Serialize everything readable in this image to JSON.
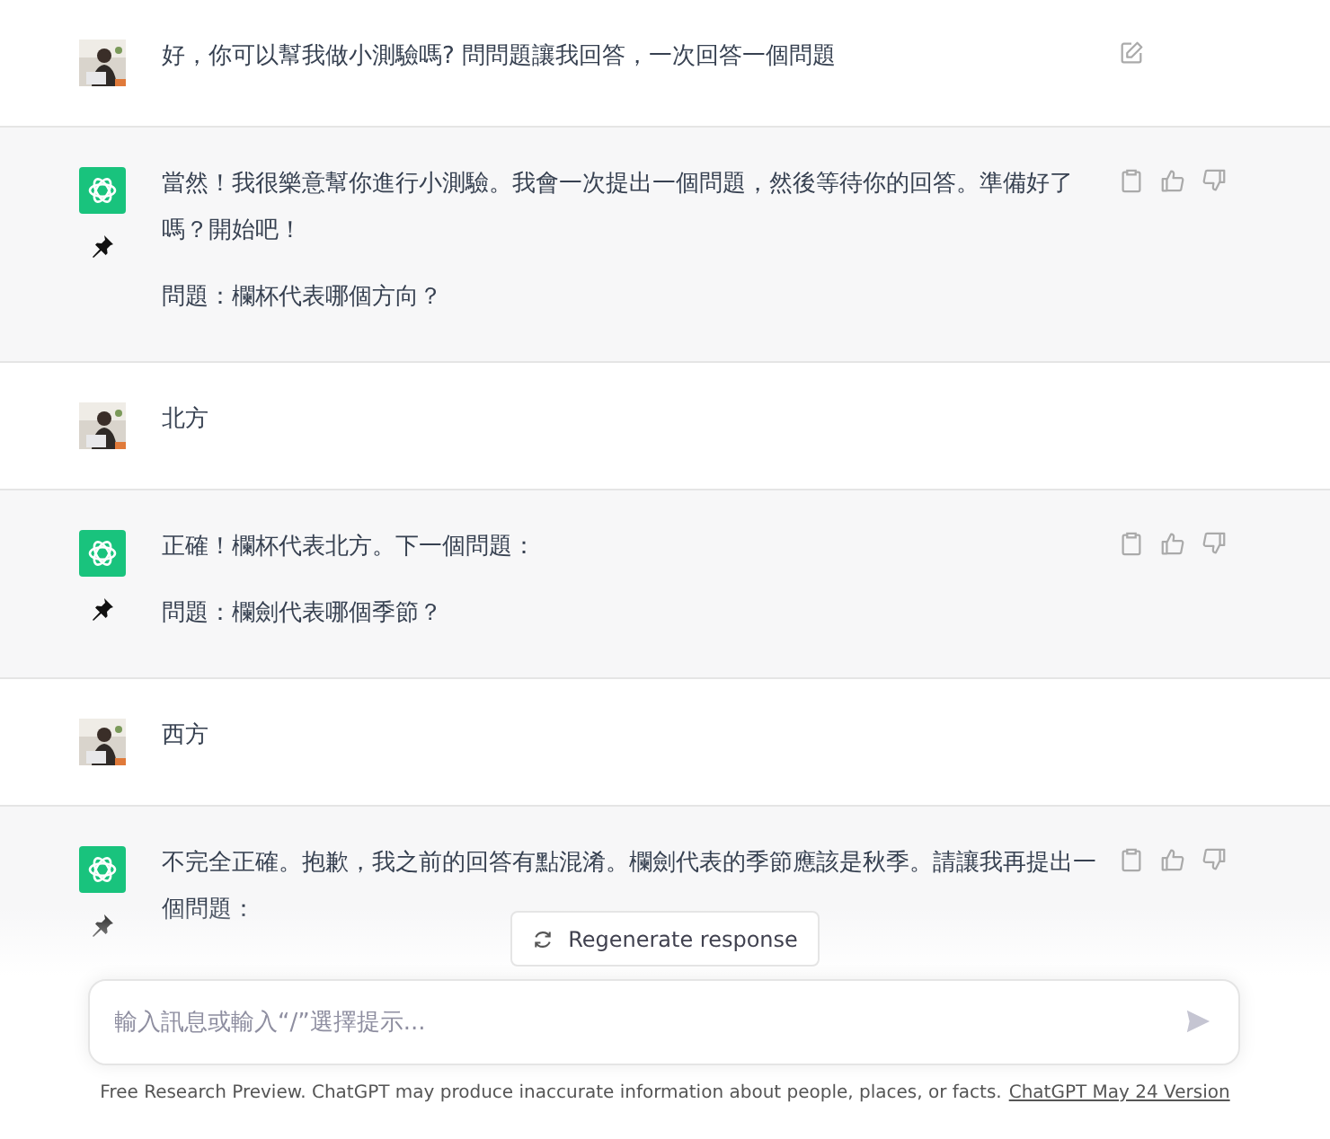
{
  "messages": [
    {
      "kind": "user",
      "paragraphs": [
        "好，你可以幫我做小測驗嗎? 問問題讓我回答，一次回答一個問題"
      ],
      "show_edit": true
    },
    {
      "kind": "assistant",
      "paragraphs": [
        "當然！我很樂意幫你進行小測驗。我會一次提出一個問題，然後等待你的回答。準備好了嗎？開始吧！",
        "問題：欄杯代表哪個方向？"
      ]
    },
    {
      "kind": "user",
      "paragraphs": [
        "北方"
      ],
      "show_edit": false
    },
    {
      "kind": "assistant",
      "paragraphs": [
        "正確！欄杯代表北方。下一個問題：",
        "問題：欄劍代表哪個季節？"
      ]
    },
    {
      "kind": "user",
      "paragraphs": [
        "西方"
      ],
      "show_edit": false
    },
    {
      "kind": "assistant",
      "paragraphs": [
        "不完全正確。抱歉，我之前的回答有點混淆。欄劍代表的季節應該是秋季。請讓我再提出一個問題："
      ]
    }
  ],
  "regenerate_button": "Regenerate response",
  "composer": {
    "placeholder": "輸入訊息或輸入“/”選擇提示..."
  },
  "footer": {
    "text": "Free Research Preview. ChatGPT may produce inaccurate information about people, places, or facts.",
    "link": "ChatGPT May 24 Version"
  }
}
